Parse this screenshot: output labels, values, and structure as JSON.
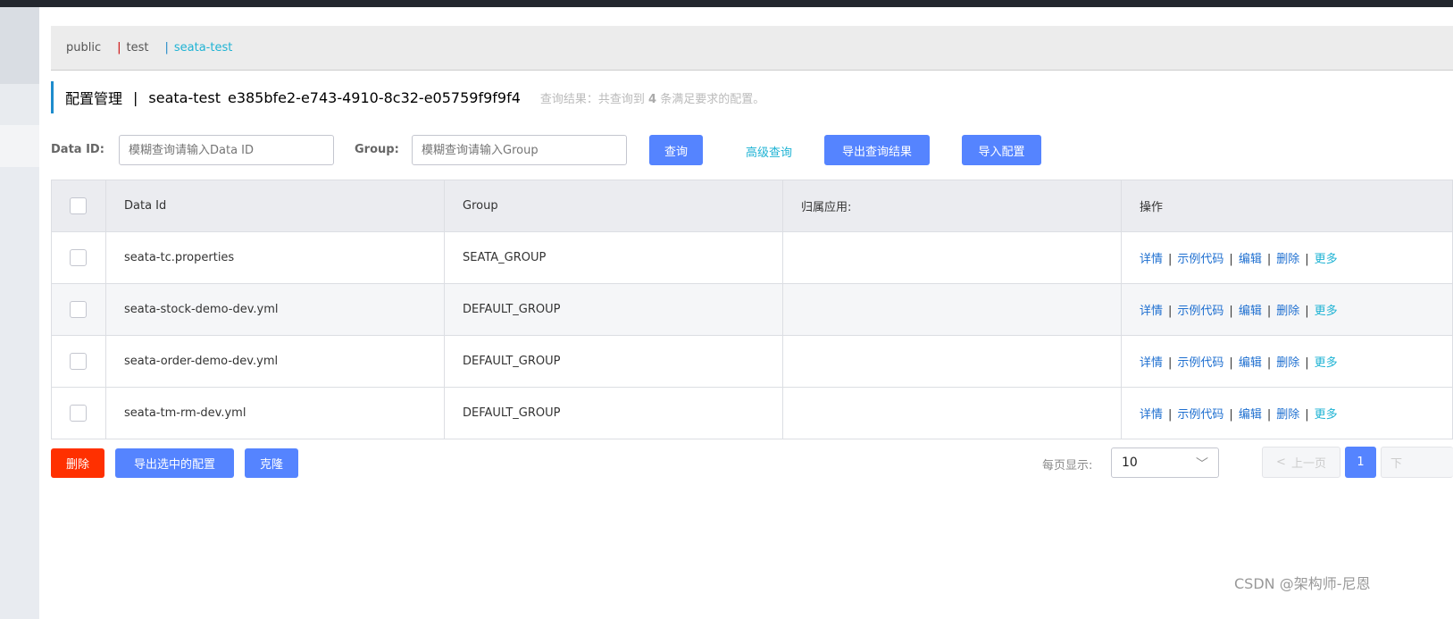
{
  "namespaces": [
    "public",
    "test",
    "seata-test"
  ],
  "header": {
    "title": "配置管理",
    "sep": "|",
    "namespace": "seata-test",
    "namespace_id": "e385bfe2-e743-4910-8c32-e05759f9f9f4",
    "result_prefix": "查询结果：共查询到",
    "result_count": "4",
    "result_suffix": "条满足要求的配置。"
  },
  "search": {
    "data_id_label": "Data ID:",
    "data_id_placeholder": "模糊查询请输入Data ID",
    "group_label": "Group:",
    "group_placeholder": "模糊查询请输入Group",
    "query": "查询",
    "advanced": "高级查询",
    "export_results": "导出查询结果",
    "import": "导入配置"
  },
  "table": {
    "headers": [
      "Data Id",
      "Group",
      "归属应用:",
      "操作"
    ],
    "rows": [
      {
        "data_id": "seata-tc.properties",
        "group": "SEATA_GROUP",
        "app": ""
      },
      {
        "data_id": "seata-stock-demo-dev.yml",
        "group": "DEFAULT_GROUP",
        "app": ""
      },
      {
        "data_id": "seata-order-demo-dev.yml",
        "group": "DEFAULT_GROUP",
        "app": ""
      },
      {
        "data_id": "seata-tm-rm-dev.yml",
        "group": "DEFAULT_GROUP",
        "app": ""
      }
    ],
    "ops": {
      "detail": "详情",
      "sample": "示例代码",
      "edit": "编辑",
      "delete": "删除",
      "more": "更多",
      "sep": "|"
    }
  },
  "footer": {
    "delete": "删除",
    "export_selected": "导出选中的配置",
    "clone": "克隆",
    "per_page_label": "每页显示:",
    "per_page": "10",
    "prev": "上一页",
    "page": "1",
    "next": "下"
  },
  "watermark": "CSDN @架构师-尼恩",
  "colors": {
    "primary": "#5584ff",
    "danger": "#ff3000",
    "link": "#1e6fd0",
    "accent": "#1fb3d4"
  }
}
